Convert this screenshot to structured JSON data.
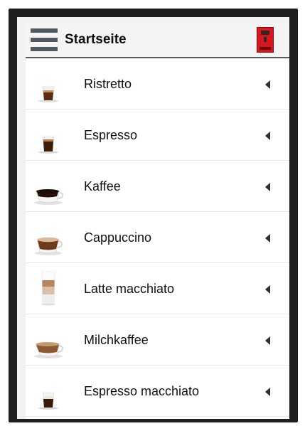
{
  "header": {
    "title": "Startseite",
    "menu_icon": "hamburger-menu-icon",
    "machine_icon": "coffee-machine-icon",
    "machine_color": "#d8161d"
  },
  "drinks": [
    {
      "label": "Ristretto",
      "icon": "ristretto-cup-icon"
    },
    {
      "label": "Espresso",
      "icon": "espresso-cup-icon"
    },
    {
      "label": "Kaffee",
      "icon": "coffee-cup-icon"
    },
    {
      "label": "Cappuccino",
      "icon": "cappuccino-cup-icon"
    },
    {
      "label": "Latte macchiato",
      "icon": "latte-macchiato-glass-icon"
    },
    {
      "label": "Milchkaffee",
      "icon": "milk-coffee-cup-icon"
    },
    {
      "label": "Espresso macchiato",
      "icon": "espresso-macchiato-cup-icon"
    }
  ],
  "colors": {
    "header_bar": "#555a5e",
    "arrow": "#2e2e2e"
  }
}
